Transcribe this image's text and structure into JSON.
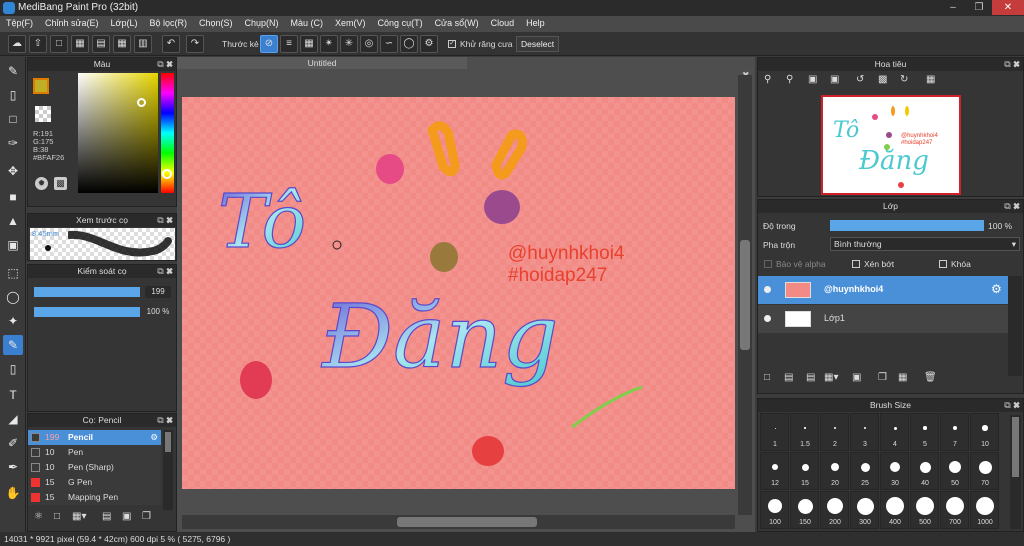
{
  "window": {
    "title": "MediBang Paint Pro (32bit)"
  },
  "menu": [
    "Tệp(F)",
    "Chỉnh sửa(E)",
    "Lớp(L)",
    "Bộ lọc(R)",
    "Chọn(S)",
    "Chụp(N)",
    "Màu (C)",
    "Xem(V)",
    "Công cụ(T)",
    "Cửa sổ(W)",
    "Cloud",
    "Help"
  ],
  "toolbar": {
    "ruler_label": "Thước kẻ",
    "antialias_label": "Khử răng cưa",
    "deselect_label": "Deselect"
  },
  "color_panel": {
    "title": "Màu",
    "r": "R:191",
    "g": "G:175",
    "b": "B:38",
    "hex": "#BFAF26",
    "current_color": "#BFAF26"
  },
  "brush_preview": {
    "title": "Xem trước cọ",
    "size": "8.45mm"
  },
  "brush_control": {
    "title": "Kiểm soát cọ",
    "size_value": "199",
    "opacity_value": "100 %"
  },
  "brush_panel": {
    "title": "Cọ: Pencil",
    "items": [
      {
        "size": "199",
        "name": "Pencil",
        "color": "#3a3a3a",
        "selected": true
      },
      {
        "size": "10",
        "name": "Pen",
        "color": "#3a3a3a",
        "selected": false
      },
      {
        "size": "10",
        "name": "Pen (Sharp)",
        "color": "#3a3a3a",
        "selected": false
      },
      {
        "size": "15",
        "name": "G Pen",
        "color": "#e33",
        "selected": false
      },
      {
        "size": "15",
        "name": "Mapping Pen",
        "color": "#e33",
        "selected": false
      }
    ]
  },
  "canvas": {
    "tab": "Untitled",
    "text_line1": "@huynhkhoi4",
    "text_line2": "#hoidap247",
    "title_line1": "Tô",
    "title_line2": "Đăng"
  },
  "navigator": {
    "title": "Hoa tiêu"
  },
  "layer_panel": {
    "title": "Lớp",
    "opacity_label": "Độ trong",
    "opacity_value": "100 %",
    "blend_label": "Pha trộn",
    "blend_value": "Bình thường",
    "protect_alpha": "Bảo vệ alpha",
    "clipping": "Xén bớt",
    "lock": "Khóa",
    "layers": [
      {
        "name": "@huynhkhoi4",
        "selected": true
      },
      {
        "name": "Lớp1",
        "selected": false
      }
    ]
  },
  "brush_size_panel": {
    "title": "Brush Size",
    "sizes": [
      "1",
      "1.5",
      "2",
      "3",
      "4",
      "5",
      "7",
      "10",
      "12",
      "15",
      "20",
      "25",
      "30",
      "40",
      "50",
      "70",
      "100",
      "150",
      "200",
      "300",
      "400",
      "500",
      "700",
      "1000"
    ]
  },
  "status": {
    "text": "14031 * 9921 pixel  (59.4 * 42cm)  600 dpi  5 %  ( 5275, 6796 )"
  }
}
